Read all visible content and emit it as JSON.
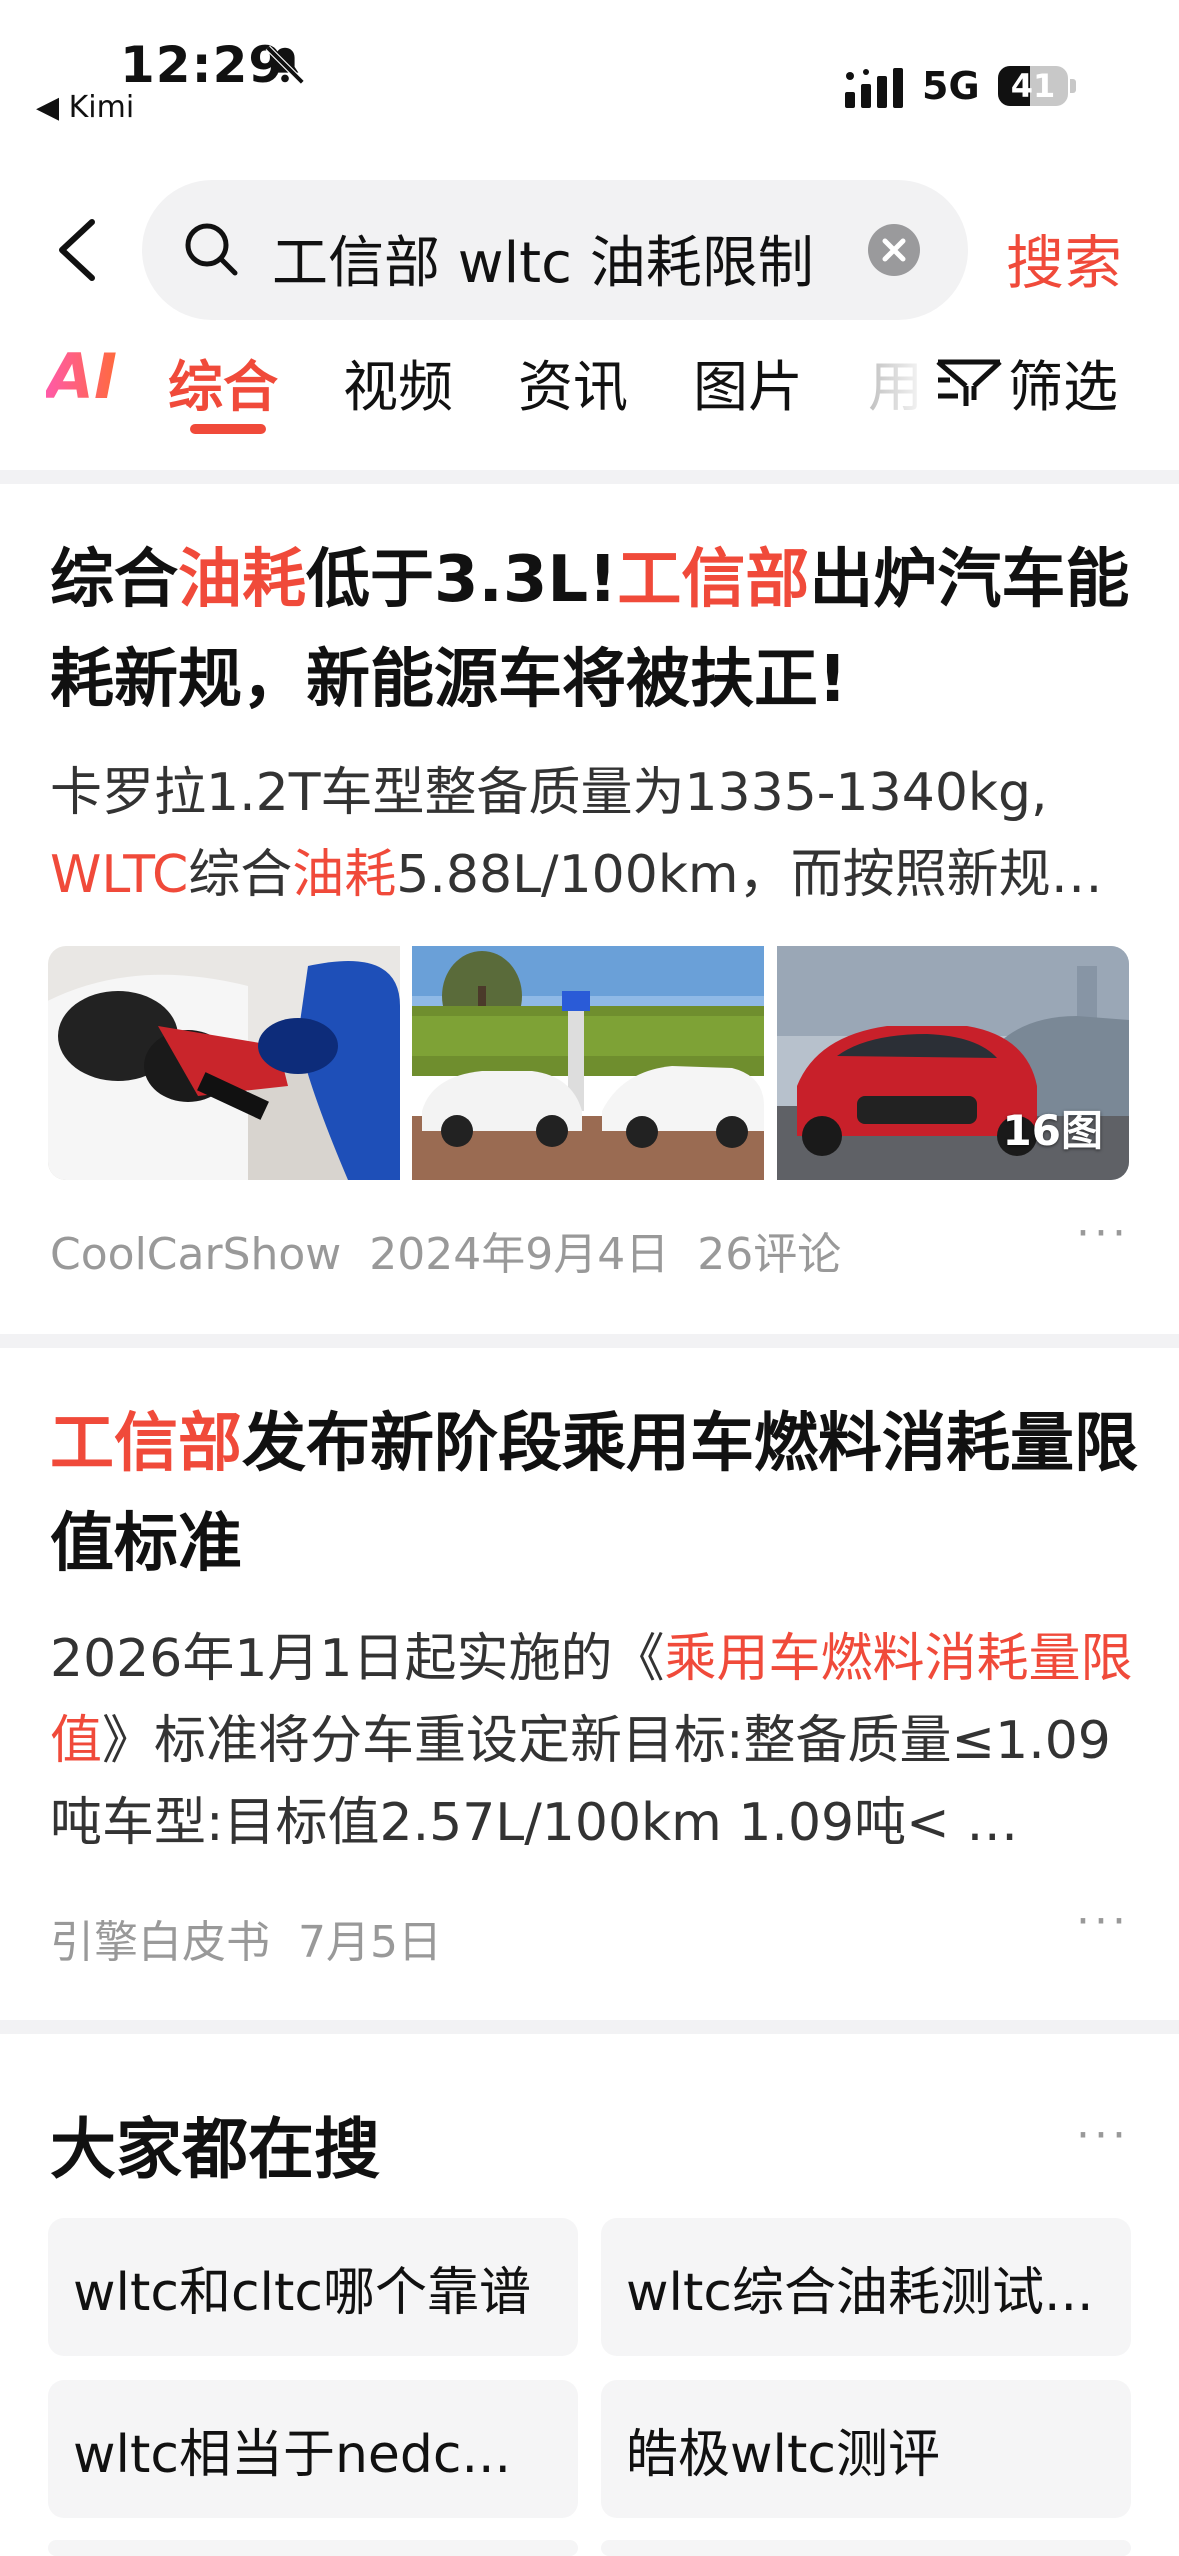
{
  "status_bar": {
    "time": "12:29",
    "back_app": "◀ Kimi",
    "network": "5G",
    "battery": "41"
  },
  "search": {
    "query": "工信部 wltc 油耗限制",
    "button_label": "搜索"
  },
  "tabs": {
    "ai": "AI",
    "items": [
      "综合",
      "视频",
      "资讯",
      "图片",
      "用"
    ],
    "active": "综合",
    "filter_label": "筛选"
  },
  "results": [
    {
      "title_parts": [
        "综合",
        "油耗",
        "低于3.3L!",
        "工信部",
        "出炉汽车能耗新规，新能源车将被扶正!"
      ],
      "summary_parts": [
        "卡罗拉1.2T车型整备质量为1335-1340kg,",
        "WLTC",
        "综合",
        "油耗",
        "5.88L/100km，而按照新规…"
      ],
      "images": [
        "fuel-nozzle-photo",
        "ev-charging-photo",
        "toyota-sedan-photo"
      ],
      "image_count": "16图",
      "source": "CoolCarShow",
      "date": "2024年9月4日",
      "comments": "26评论"
    },
    {
      "title_parts": [
        "工信部",
        "发布新阶段乘用车燃料消耗量限值标准"
      ],
      "summary_parts": [
        "2026年1月1日起实施的《",
        "乘用车燃料消耗量限值",
        "》标准将分车重设定新目标:整备质量≤1.09吨车型:目标值2.57L/100km 1.09吨< …"
      ],
      "source": "引擎白皮书",
      "date": "7月5日"
    }
  ],
  "hot_search": {
    "title": "大家都在搜",
    "items": [
      "wltc和cltc哪个靠谱",
      "wltc综合油耗测试...",
      "wltc相当于nedc...",
      "皓极wltc测评"
    ]
  },
  "colors": {
    "accent": "#f04a3a",
    "meta_gray": "#999999",
    "separator": "#f2f2f4"
  }
}
